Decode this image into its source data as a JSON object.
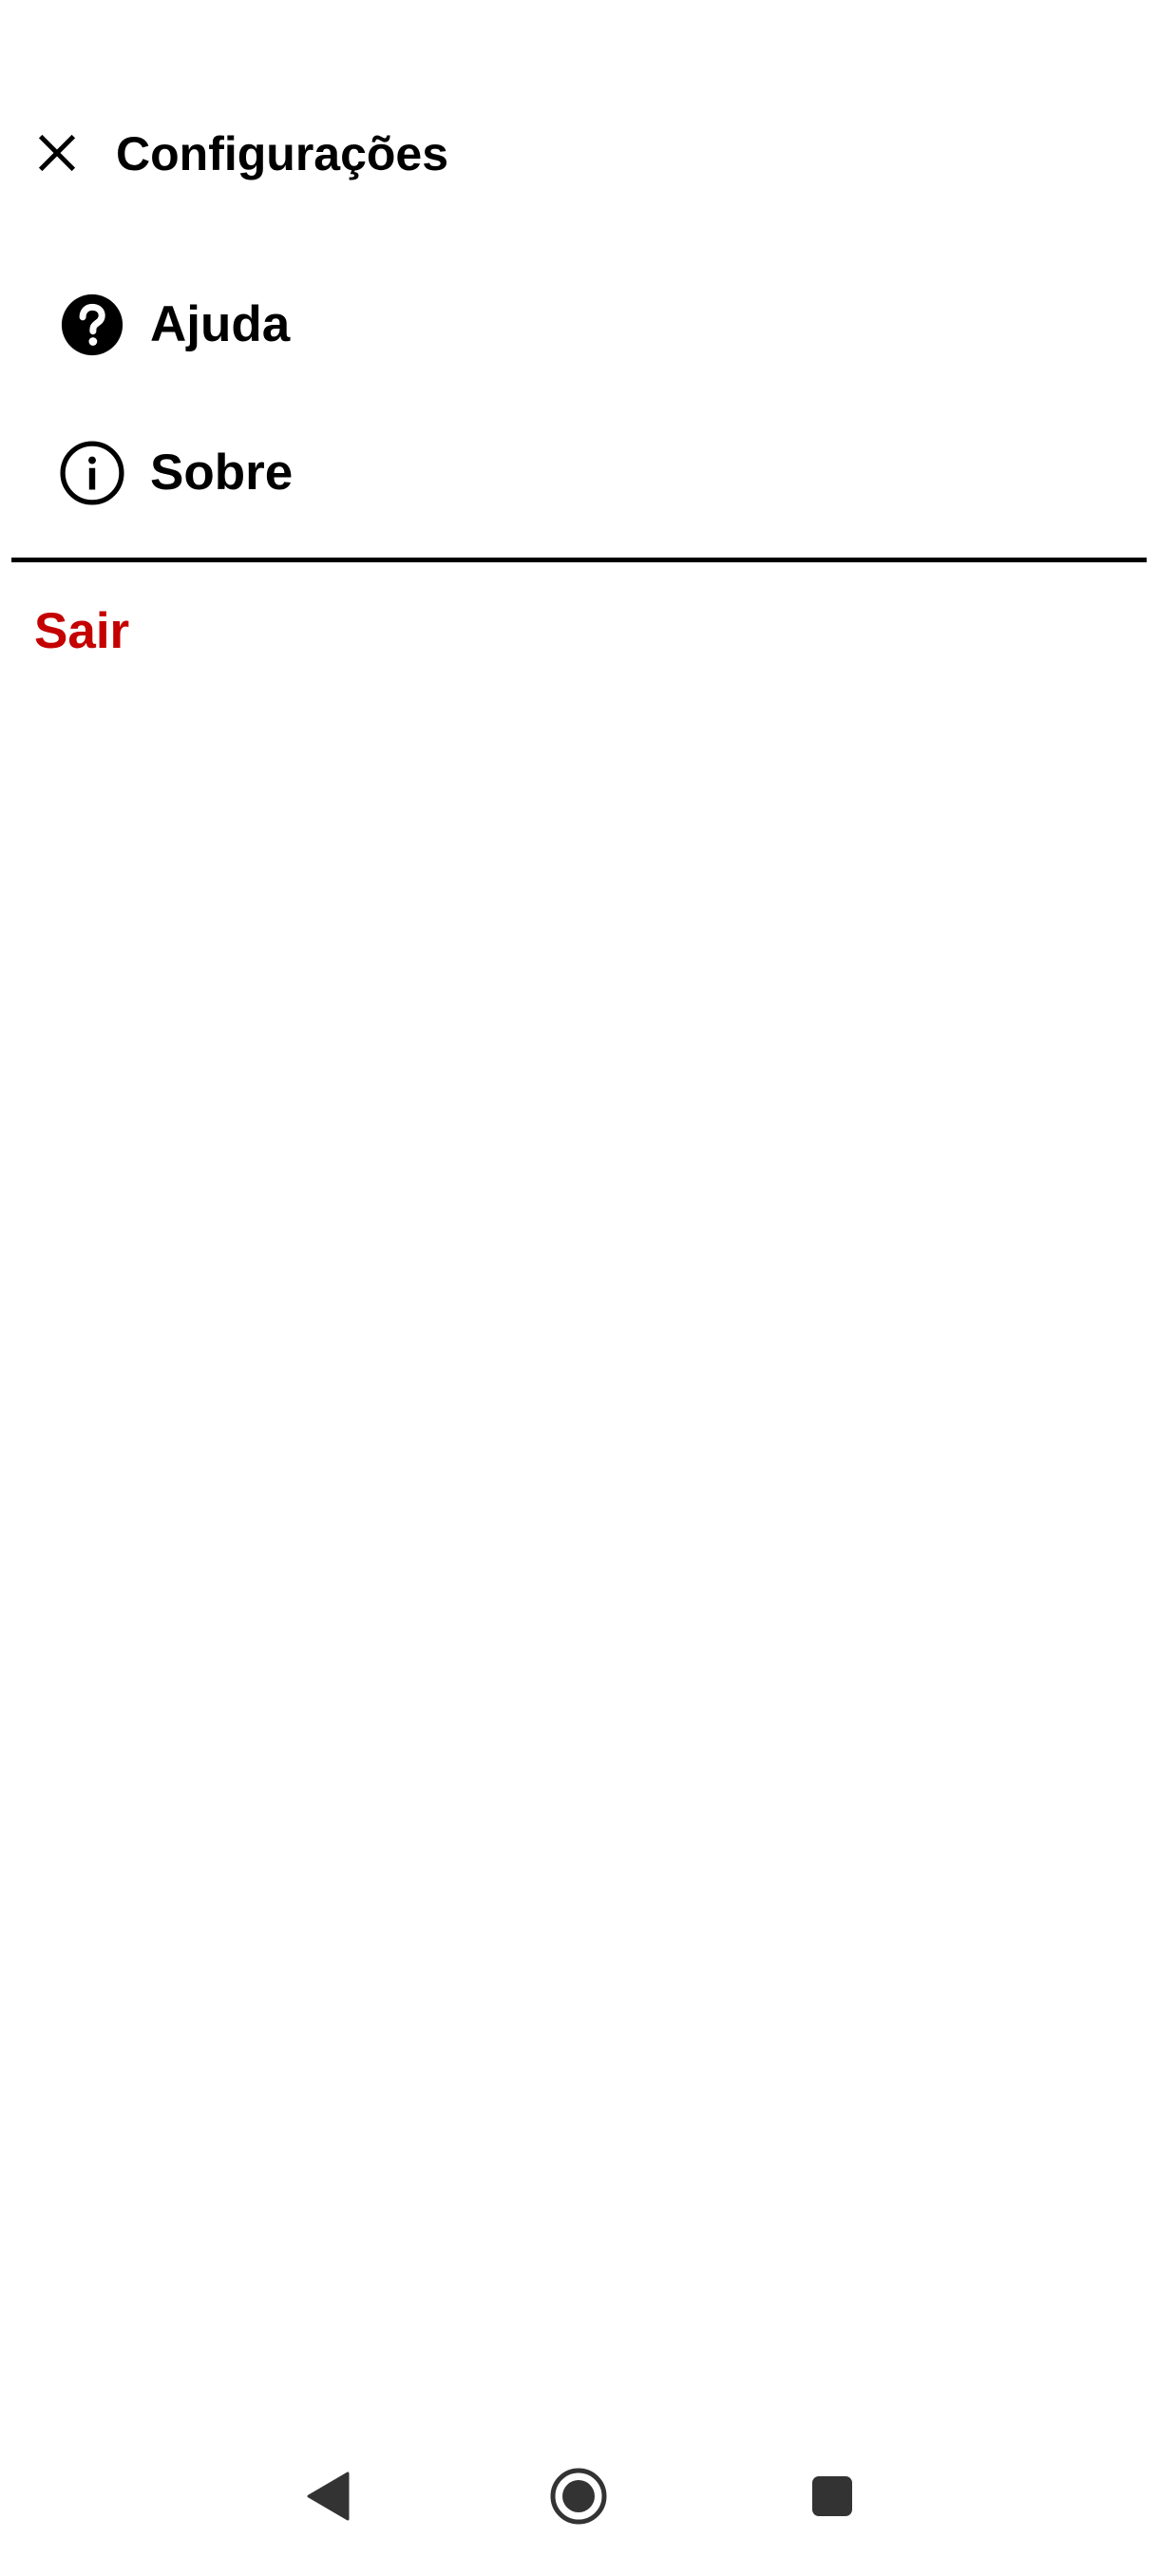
{
  "header": {
    "title": "Configurações",
    "close_icon": "close-icon"
  },
  "menu": {
    "items": [
      {
        "label": "Ajuda",
        "icon": "help-circle-icon"
      },
      {
        "label": "Sobre",
        "icon": "info-outline-icon"
      }
    ]
  },
  "logout": {
    "label": "Sair",
    "color": "#c40000"
  },
  "navbar": {
    "back_icon": "back-triangle-icon",
    "home_icon": "home-circle-icon",
    "recents_icon": "recents-square-icon",
    "icon_color": "#333333"
  }
}
